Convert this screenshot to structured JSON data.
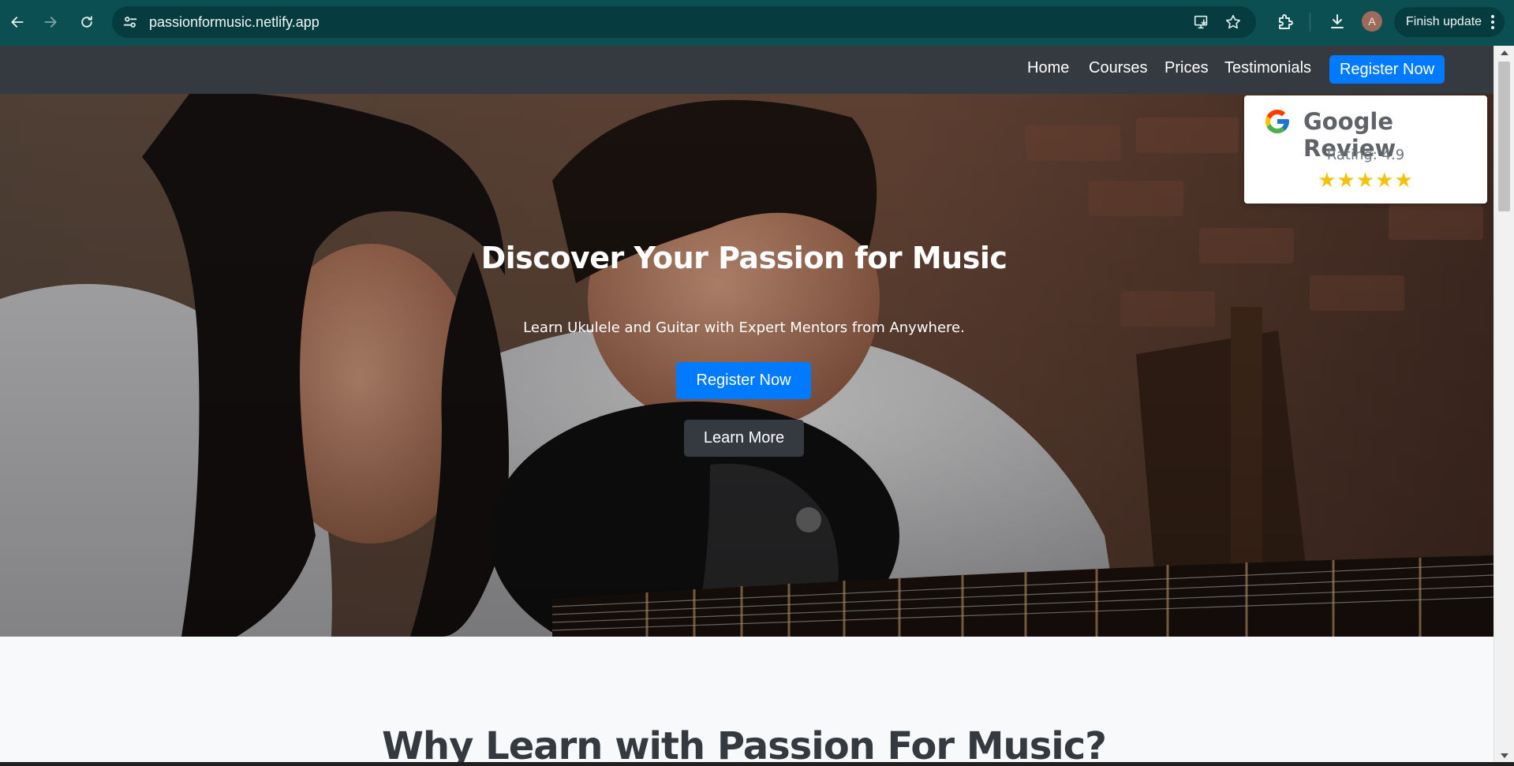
{
  "browser": {
    "url": "passionformusic.netlify.app",
    "profile_initial": "A",
    "update_label": "Finish update",
    "icons": {
      "back": "arrow-left-icon",
      "forward": "arrow-right-icon",
      "reload": "reload-icon",
      "site_info": "tune-icon",
      "install": "install-app-icon",
      "bookmark": "star-icon",
      "extensions": "puzzle-icon",
      "downloads": "download-icon",
      "menu": "kebab-menu-icon"
    }
  },
  "navbar": {
    "links": [
      "Home",
      "Courses",
      "Prices",
      "Testimonials"
    ],
    "register_label": "Register Now",
    "colors": {
      "background": "#343a40",
      "accent": "#007bff"
    }
  },
  "hero": {
    "title": "Discover Your Passion for Music",
    "subtitle": "Learn Ukulele and Guitar with Expert Mentors from Anywhere.",
    "register_label": "Register Now",
    "learn_more_label": "Learn More"
  },
  "review": {
    "title": "Google Review",
    "rating_text": "Rating: 4.9",
    "stars_text": "★★★★★",
    "stars_count": 5
  },
  "section": {
    "title": "Why Learn with Passion For Music?"
  }
}
